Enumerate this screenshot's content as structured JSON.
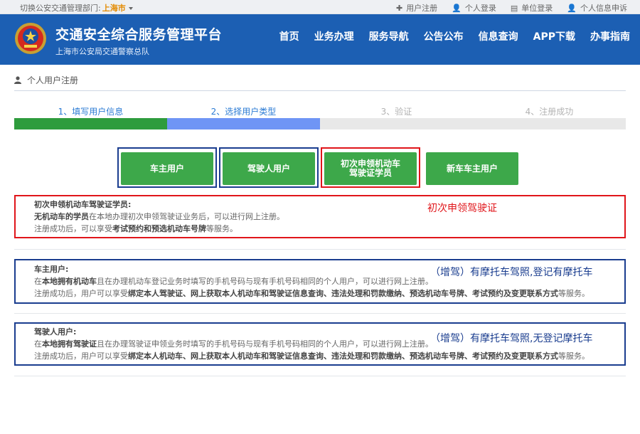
{
  "topbar": {
    "switch_label": "切换公安交通管理部门:",
    "current_city": "上海市",
    "links": [
      {
        "icon": "plus-icon",
        "glyph": "✚",
        "label": "用户注册"
      },
      {
        "icon": "user-icon",
        "glyph": "👤",
        "label": "个人登录"
      },
      {
        "icon": "document-icon",
        "glyph": "▤",
        "label": "单位登录"
      },
      {
        "icon": "user-icon",
        "glyph": "👤",
        "label": "个人信息申诉"
      }
    ]
  },
  "header": {
    "title": "交通安全综合服务管理平台",
    "subtitle": "上海市公安局交通警察总队",
    "nav": [
      "首页",
      "业务办理",
      "服务导航",
      "公告公布",
      "信息查询",
      "APP下载",
      "办事指南"
    ]
  },
  "breadcrumb": {
    "label": "个人用户注册"
  },
  "steps": [
    {
      "label": "1、填写用户信息",
      "color": "#2b7bd4",
      "bar": "#2e9c3d"
    },
    {
      "label": "2、选择用户类型",
      "color": "#2b7bd4",
      "bar": "#6f95f5"
    },
    {
      "label": "3、验证",
      "color": "#b3b3b3",
      "bar": "#e8e8e8"
    },
    {
      "label": "4、注册成功",
      "color": "#b3b3b3",
      "bar": "#e8e8e8"
    }
  ],
  "user_types": [
    {
      "label": "车主用户",
      "frame_color": "#1a3d8f"
    },
    {
      "label": "驾驶人用户",
      "frame_color": "#1a3d8f"
    },
    {
      "label_line1": "初次申领机动车",
      "label_line2": "驾驶证学员",
      "frame_color": "#e0151a"
    },
    {
      "label": "新车车主用户",
      "frame_color": ""
    }
  ],
  "boxes": {
    "student": {
      "title": "初次申领机动车驾驶证学员:",
      "line1_bold": "无机动车的学员",
      "line1_rest": "在本地办理初次申领驾驶证业务后，可以进行网上注册。",
      "line2_pre": "注册成功后，可以享受",
      "line2_bold": "考试预约和预选机动车号牌",
      "line2_post": "等服务。",
      "annotation": "初次申领驾驶证",
      "frame_color": "#e0151a",
      "annotation_color": "#e0151a"
    },
    "owner": {
      "title": "车主用户:",
      "line1_pre": "在",
      "line1_bold": "本地拥有机动车",
      "line1_rest": "且在办理机动车登记业务时填写的手机号码与现有手机号码相同的个人用户，可以进行网上注册。",
      "line2_pre": "注册成功后，用户可以享受",
      "line2_bold": "绑定本人驾驶证、网上获取本人机动车和驾驶证信息查询、违法处理和罚款缴纳、预选机动车号牌、考试预约及变更联系方式",
      "line2_post": "等服务。",
      "annotation": "（增驾）有摩托车驾照,登记有摩托车",
      "frame_color": "#1a3d8f",
      "annotation_color": "#1a3d8f"
    },
    "driver": {
      "title": "驾驶人用户:",
      "line1_pre": "在",
      "line1_bold": "本地拥有驾驶证",
      "line1_rest": "且在办理驾驶证申领业务时填写的手机号码与现有手机号码相同的个人用户，可以进行网上注册。",
      "line2_pre": "注册成功后，用户可以享受",
      "line2_bold": "绑定本人机动车、网上获取本人机动车和驾驶证信息查询、违法处理和罚款缴纳、预选机动车号牌、考试预约及变更联系方式",
      "line2_post": "等服务。",
      "annotation": "（增驾）有摩托车驾照,无登记摩托车",
      "frame_color": "#1a3d8f",
      "annotation_color": "#1a3d8f"
    }
  }
}
